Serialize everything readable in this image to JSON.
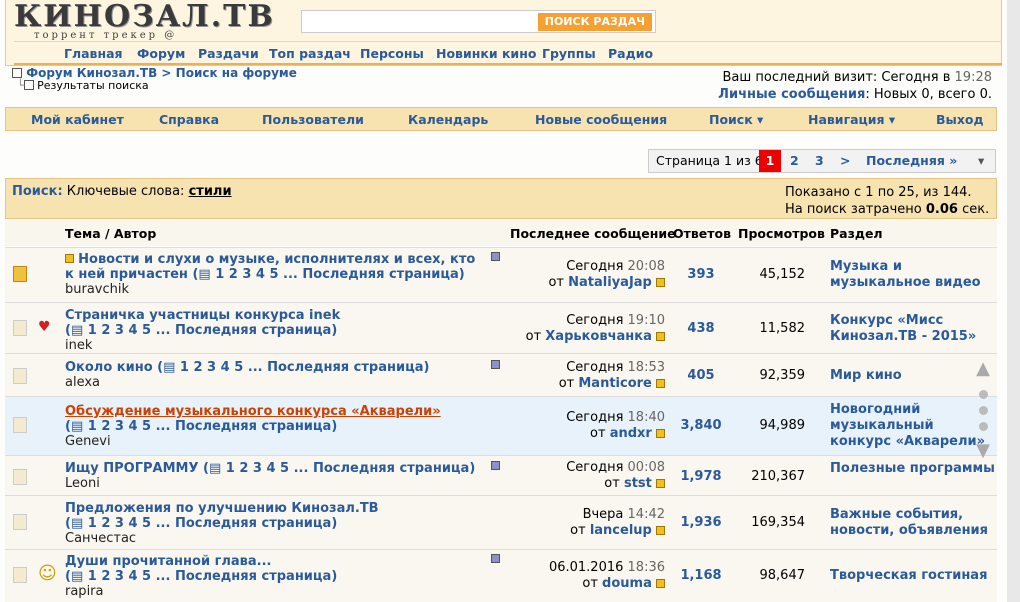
{
  "header": {
    "logo_text": "КИНОЗАЛ.ТВ",
    "logo_sub": "торрент трекер @",
    "search_button": "ПОИСК РАЗДАЧ",
    "search_placeholder": ""
  },
  "nav": [
    "Главная",
    "Форум",
    "Раздачи",
    "Топ раздач",
    "Персоны",
    "Новинки кино",
    "Группы",
    "Радио"
  ],
  "breadcrumb": {
    "forum": "Форум Кинозал.ТВ",
    "sep": " > ",
    "search": "Поиск на форуме",
    "results": "Результаты поиска"
  },
  "visit": {
    "label": "Ваш последний визит:",
    "day": "Сегодня в",
    "time": "19:28",
    "pm_label": "Личные сообщения",
    "pm_text": ": Новых 0, всего 0."
  },
  "menu": [
    "Мой кабинет",
    "Справка",
    "Пользователи",
    "Календарь",
    "Новые сообщения",
    "Поиск ▾",
    "Навигация ▾",
    "Выход"
  ],
  "pager": {
    "label": "Страница 1 из 6",
    "current": "1",
    "pages": [
      "2",
      "3",
      ">",
      "Последняя »"
    ],
    "menu": "▾"
  },
  "search_info": {
    "label": "Поиск:",
    "kw_label": "Ключевые слова:",
    "keyword": "стили",
    "shown": "Показано с 1 по 25, из 144.",
    "time_label": "На поиск затрачено",
    "time_value": "0.06",
    "time_unit": "сек."
  },
  "columns": {
    "topic": "Тема / Автор",
    "last": "Последнее сообщение",
    "replies": "Ответов",
    "views": "Просмотров",
    "section": "Раздел"
  },
  "rows": [
    {
      "title": "Новости и слухи о музыке, исполнителях и всех, кто к ней причастен",
      "pages": " (▤ 1 2 3 4 5 ... Последняя страница)",
      "author": "buravchik",
      "last_day": "Сегодня",
      "last_time": "20:08",
      "from": "от",
      "last_user": "NataliyaJap",
      "replies": "393",
      "views": "45,152",
      "section": "Музыка и музыкальное видео",
      "mood": ""
    },
    {
      "title": "Страничка участницы конкурса inek",
      "pages": "(▤ 1 2 3 4 5 ... Последняя страница)",
      "author": "inek",
      "last_day": "Сегодня",
      "last_time": "19:10",
      "from": "от",
      "last_user": "Харьковчанка",
      "replies": "438",
      "views": "11,582",
      "section": "Конкурс «Мисс Кинозал.ТВ - 2015»",
      "mood": "♥"
    },
    {
      "title": "Около кино",
      "pages": " (▤ 1 2 3 4 5 ... Последняя страница)",
      "author": "alexa",
      "last_day": "Сегодня",
      "last_time": "18:53",
      "from": "от",
      "last_user": "Manticore",
      "replies": "405",
      "views": "92,359",
      "section": "Мир кино",
      "mood": ""
    },
    {
      "title": "Обсуждение музыкального конкурса «Акварели»",
      "pages": "(▤ 1 2 3 4 5 ... Последняя страница)",
      "author": "Genevi",
      "last_day": "Сегодня",
      "last_time": "18:40",
      "from": "от",
      "last_user": "andxr",
      "replies": "3,840",
      "views": "94,989",
      "section": "Новогодний музыкальный конкурс «Акварели»",
      "mood": ""
    },
    {
      "title": "Ищу ПРОГРАММУ",
      "pages": " (▤ 1 2 3 4 5 ... Последняя страница)",
      "author": "Leoni",
      "last_day": "Сегодня",
      "last_time": "00:08",
      "from": "от",
      "last_user": "stst",
      "replies": "1,978",
      "views": "210,367",
      "section": "Полезные программы",
      "mood": ""
    },
    {
      "title": "Предложения по улучшению Кинозал.ТВ",
      "pages": "(▤ 1 2 3 4 5 ... Последняя страница)",
      "author": "Санчестас",
      "last_day": "Вчера",
      "last_time": "14:42",
      "from": "от",
      "last_user": "lancelup",
      "replies": "1,936",
      "views": "169,354",
      "section": "Важные события, новости, объявления",
      "mood": ""
    },
    {
      "title": "Души прочитанной глава...",
      "pages": "(▤ 1 2 3 4 5 ... Последняя страница)",
      "author": "rapira",
      "last_day": "06.01.2016",
      "last_time": "18:36",
      "from": "от",
      "last_user": "douma",
      "replies": "1,168",
      "views": "98,647",
      "section": "Творческая гостиная",
      "mood": "☺"
    }
  ]
}
